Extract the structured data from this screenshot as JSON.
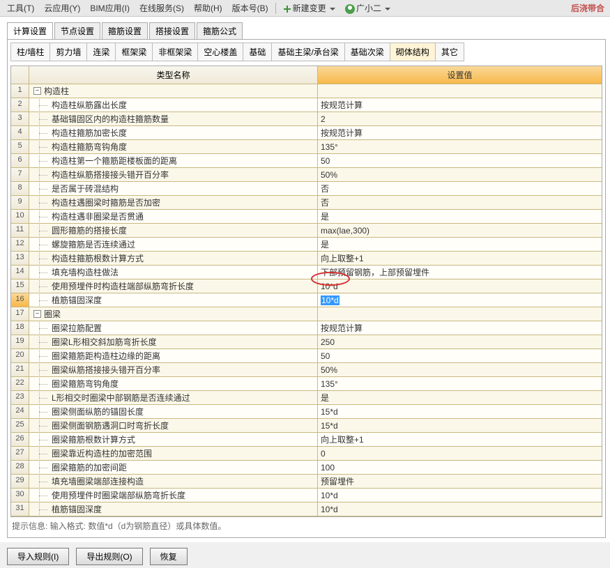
{
  "menu": {
    "items": [
      "工具(T)",
      "云应用(Y)",
      "BIM应用(I)",
      "在线服务(S)",
      "帮助(H)",
      "版本号(B)"
    ],
    "new_change": "新建变更",
    "user": "广小二",
    "right_label": "后浇带合"
  },
  "top_tabs": [
    "计算设置",
    "节点设置",
    "箍筋设置",
    "搭接设置",
    "箍筋公式"
  ],
  "sub_tabs": [
    "柱/墙柱",
    "剪力墙",
    "连梁",
    "框架梁",
    "非框架梁",
    "空心楼盖",
    "基础",
    "基础主梁/承台梁",
    "基础次梁",
    "砌体结构",
    "其它"
  ],
  "grid": {
    "head_name": "类型名称",
    "head_val": "设置值",
    "rows": [
      {
        "n": 1,
        "t": "section",
        "name": "构造柱",
        "val": ""
      },
      {
        "n": 2,
        "t": "item",
        "name": "构造柱纵筋露出长度",
        "val": "按规范计算"
      },
      {
        "n": 3,
        "t": "item",
        "name": "基础锚固区内的构造柱箍筋数量",
        "val": "2"
      },
      {
        "n": 4,
        "t": "item",
        "name": "构造柱箍筋加密长度",
        "val": "按规范计算"
      },
      {
        "n": 5,
        "t": "item",
        "name": "构造柱箍筋弯钩角度",
        "val": "135°"
      },
      {
        "n": 6,
        "t": "item",
        "name": "构造柱第一个箍筋距楼板面的距离",
        "val": "50"
      },
      {
        "n": 7,
        "t": "item",
        "name": "构造柱纵筋搭接接头错开百分率",
        "val": "50%"
      },
      {
        "n": 8,
        "t": "item",
        "name": "是否属于砖混结构",
        "val": "否"
      },
      {
        "n": 9,
        "t": "item",
        "name": "构造柱遇圈梁时箍筋是否加密",
        "val": "否"
      },
      {
        "n": 10,
        "t": "item",
        "name": "构造柱遇非圈梁是否贯通",
        "val": "是"
      },
      {
        "n": 11,
        "t": "item",
        "name": "圆形箍筋的搭接长度",
        "val": "max(lae,300)"
      },
      {
        "n": 12,
        "t": "item",
        "name": "螺旋箍筋是否连续通过",
        "val": "是"
      },
      {
        "n": 13,
        "t": "item",
        "name": "构造柱箍筋根数计算方式",
        "val": "向上取整+1"
      },
      {
        "n": 14,
        "t": "item",
        "name": "填充墙构造柱做法",
        "val": "下部预留钢筋，上部预留埋件"
      },
      {
        "n": 15,
        "t": "item",
        "name": "使用预埋件时构造柱端部纵筋弯折长度",
        "val": "10*d"
      },
      {
        "n": 16,
        "t": "item",
        "name": "植筋锚固深度",
        "val": "10*d",
        "hl": true
      },
      {
        "n": 17,
        "t": "section",
        "name": "圈梁",
        "val": ""
      },
      {
        "n": 18,
        "t": "item",
        "name": "圈梁拉筋配置",
        "val": "按规范计算"
      },
      {
        "n": 19,
        "t": "item",
        "name": "圈梁L形相交斜加筋弯折长度",
        "val": "250"
      },
      {
        "n": 20,
        "t": "item",
        "name": "圈梁箍筋距构造柱边缘的距离",
        "val": "50"
      },
      {
        "n": 21,
        "t": "item",
        "name": "圈梁纵筋搭接接头错开百分率",
        "val": "50%"
      },
      {
        "n": 22,
        "t": "item",
        "name": "圈梁箍筋弯钩角度",
        "val": "135°"
      },
      {
        "n": 23,
        "t": "item",
        "name": "L形相交时圈梁中部钢筋是否连续通过",
        "val": "是"
      },
      {
        "n": 24,
        "t": "item",
        "name": "圈梁侧面纵筋的锚固长度",
        "val": "15*d"
      },
      {
        "n": 25,
        "t": "item",
        "name": "圈梁侧面钢筋遇洞口时弯折长度",
        "val": "15*d"
      },
      {
        "n": 26,
        "t": "item",
        "name": "圈梁箍筋根数计算方式",
        "val": "向上取整+1"
      },
      {
        "n": 27,
        "t": "item",
        "name": "圈梁靠近构造柱的加密范围",
        "val": "0"
      },
      {
        "n": 28,
        "t": "item",
        "name": "圈梁箍筋的加密间距",
        "val": "100"
      },
      {
        "n": 29,
        "t": "item",
        "name": "填充墙圈梁端部连接构造",
        "val": "预留埋件"
      },
      {
        "n": 30,
        "t": "item",
        "name": "使用预埋件时圈梁端部纵筋弯折长度",
        "val": "10*d"
      },
      {
        "n": 31,
        "t": "item",
        "name": "植筋锚固深度",
        "val": "10*d"
      }
    ]
  },
  "hint": "提示信息: 输入格式: 数值*d（d为钢筋直径）或具体数值。",
  "buttons": {
    "import": "导入规则(I)",
    "export": "导出规则(O)",
    "restore": "恢复"
  }
}
